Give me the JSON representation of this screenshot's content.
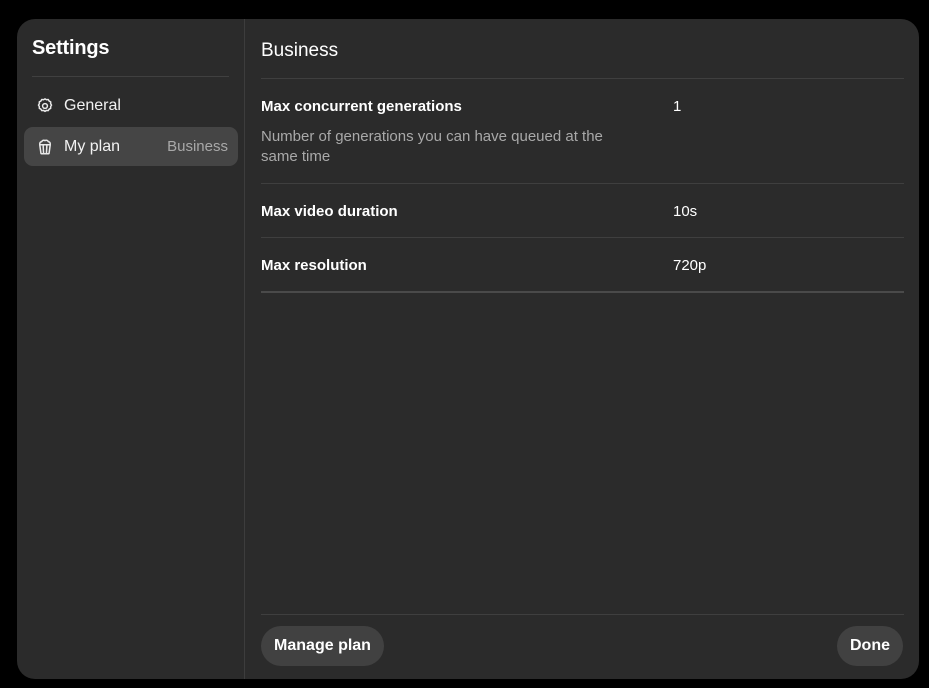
{
  "sidebar": {
    "title": "Settings",
    "items": [
      {
        "label": "General",
        "icon": "gear-icon",
        "badge": "",
        "active": false
      },
      {
        "label": "My plan",
        "icon": "popcorn-bucket-icon",
        "badge": "Business",
        "active": true
      }
    ]
  },
  "main": {
    "title": "Business",
    "rows": [
      {
        "name": "Max concurrent generations",
        "description": "Number of generations you can have queued at the same time",
        "value": "1"
      },
      {
        "name": "Max video duration",
        "description": "",
        "value": "10s"
      },
      {
        "name": "Max resolution",
        "description": "",
        "value": "720p"
      }
    ]
  },
  "footer": {
    "manage_label": "Manage plan",
    "done_label": "Done"
  },
  "colors": {
    "background": "#000000",
    "panel": "#2b2b2b",
    "active_item": "#454545",
    "button": "#414141",
    "muted_text": "#a9a9a9"
  }
}
